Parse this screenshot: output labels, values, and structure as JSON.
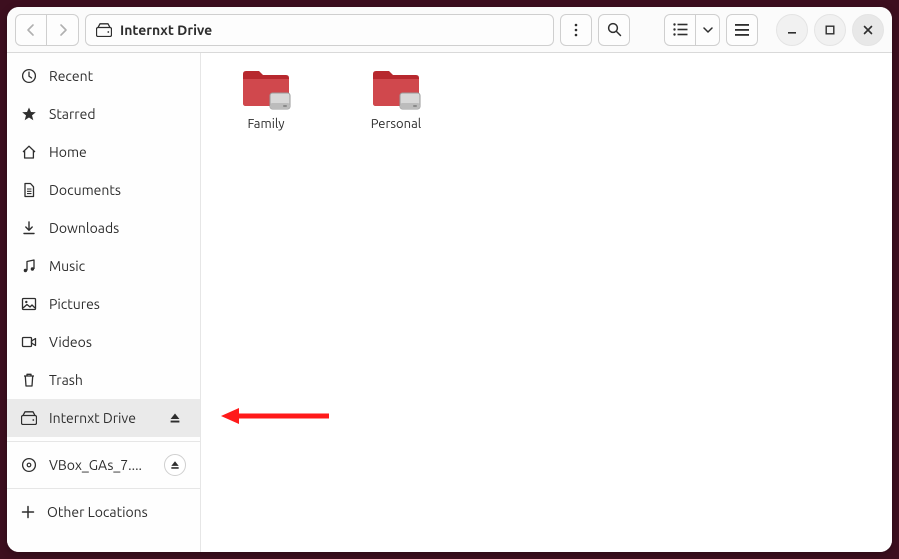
{
  "header": {
    "location_label": "Internxt Drive"
  },
  "sidebar": {
    "items": [
      {
        "label": "Recent"
      },
      {
        "label": "Starred"
      },
      {
        "label": "Home"
      },
      {
        "label": "Documents"
      },
      {
        "label": "Downloads"
      },
      {
        "label": "Music"
      },
      {
        "label": "Pictures"
      },
      {
        "label": "Videos"
      },
      {
        "label": "Trash"
      },
      {
        "label": "Internxt Drive"
      },
      {
        "label": "VBox_GAs_7...."
      },
      {
        "label": "Other Locations"
      }
    ]
  },
  "content": {
    "folders": [
      {
        "label": "Family"
      },
      {
        "label": "Personal"
      }
    ]
  }
}
